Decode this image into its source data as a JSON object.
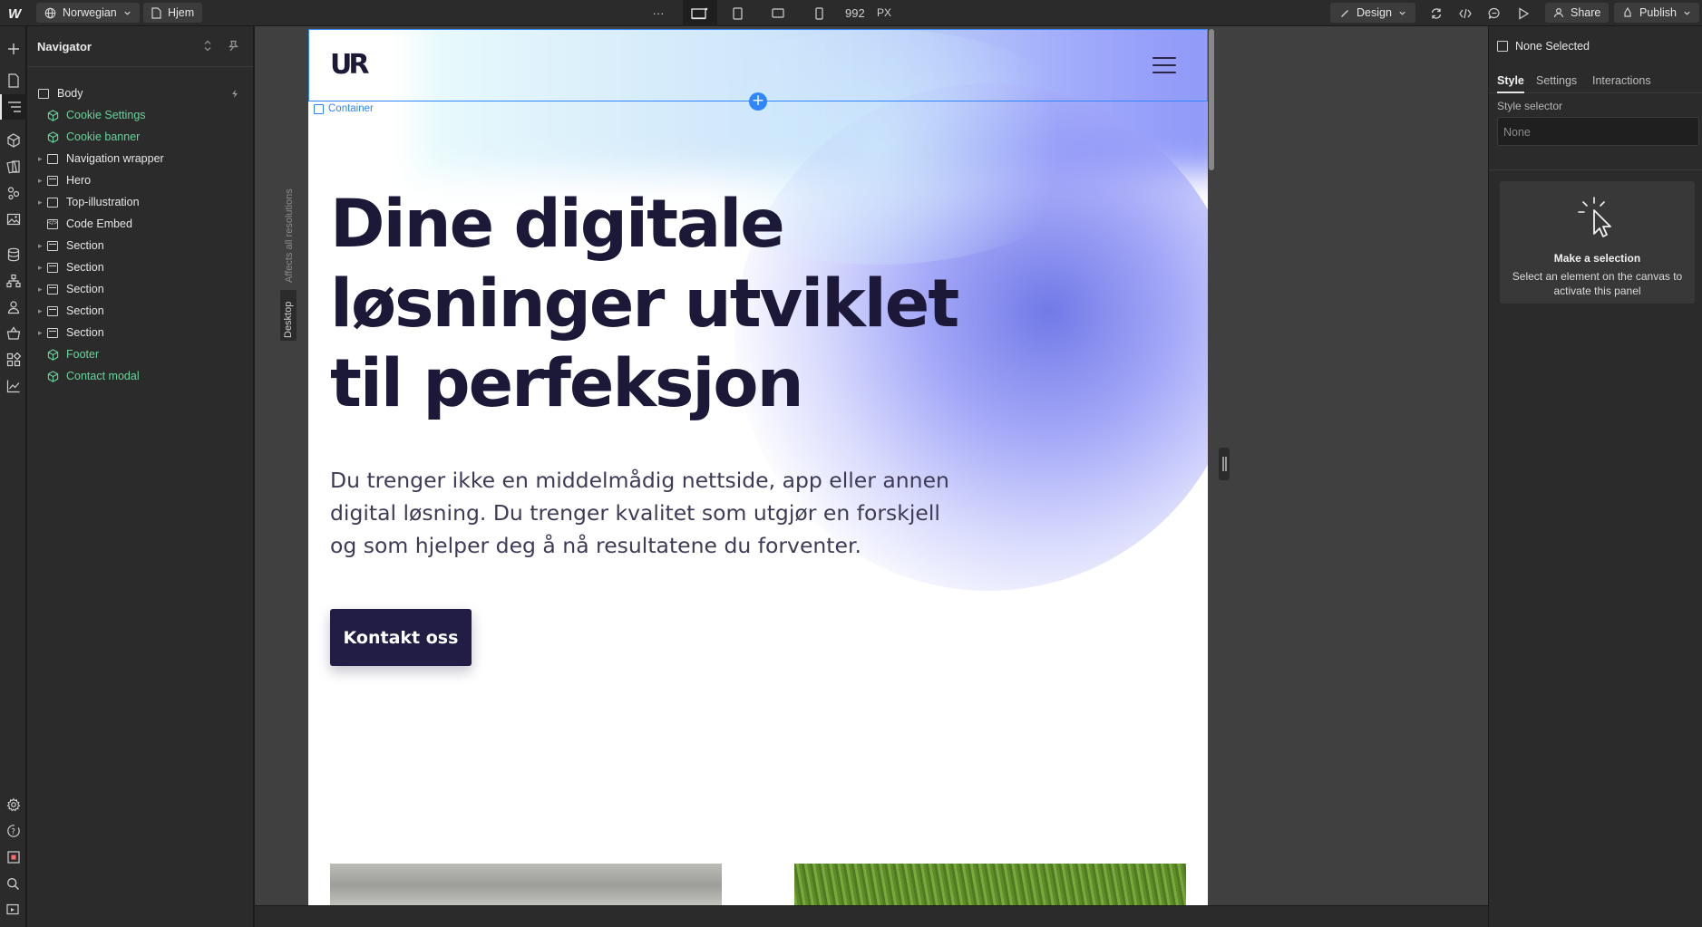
{
  "topbar": {
    "locale_label": "Norwegian",
    "page_label": "Hjem",
    "more_label": "···",
    "width_value": "992",
    "width_unit": "PX",
    "mode_label": "Design",
    "share_label": "Share",
    "publish_label": "Publish"
  },
  "navigator": {
    "title": "Navigator",
    "tree": [
      {
        "label": "Body",
        "kind": "element",
        "indent": 0,
        "expander": false
      },
      {
        "label": "Cookie Settings",
        "kind": "component",
        "indent": 1,
        "expander": false
      },
      {
        "label": "Cookie banner",
        "kind": "component",
        "indent": 1,
        "expander": false
      },
      {
        "label": "Navigation wrapper",
        "kind": "element",
        "indent": 1,
        "expander": true
      },
      {
        "label": "Hero",
        "kind": "section",
        "indent": 1,
        "expander": true
      },
      {
        "label": "Top-illustration",
        "kind": "element",
        "indent": 1,
        "expander": true
      },
      {
        "label": "Code Embed",
        "kind": "code",
        "indent": 1,
        "expander": false
      },
      {
        "label": "Section",
        "kind": "section",
        "indent": 1,
        "expander": true
      },
      {
        "label": "Section",
        "kind": "section",
        "indent": 1,
        "expander": true
      },
      {
        "label": "Section",
        "kind": "section",
        "indent": 1,
        "expander": true
      },
      {
        "label": "Section",
        "kind": "section",
        "indent": 1,
        "expander": true
      },
      {
        "label": "Section",
        "kind": "section",
        "indent": 1,
        "expander": true
      },
      {
        "label": "Footer",
        "kind": "component",
        "indent": 1,
        "expander": false
      },
      {
        "label": "Contact modal",
        "kind": "component",
        "indent": 1,
        "expander": false
      }
    ]
  },
  "canvas": {
    "affects_label": "Affects all resolutions",
    "breakpoint_label": "Desktop",
    "selection_label": "Container"
  },
  "site": {
    "logo": "UR",
    "hero_heading": "Dine digitale løsninger utviklet til perfeksjon",
    "hero_text": "Du trenger ikke en middelmådig nettside, app eller annen digital løsning. Du trenger kvalitet som utgjør en forskjell og som hjelper deg å nå resultatene du forventer.",
    "cta_label": "Kontakt oss"
  },
  "right_panel": {
    "selection_state": "None Selected",
    "tabs": [
      "Style",
      "Settings",
      "Interactions"
    ],
    "style_selector_label": "Style selector",
    "style_selector_placeholder": "None",
    "empty_title": "Make a selection",
    "empty_text": "Select an element on the canvas to activate this panel"
  },
  "colors": {
    "accent": "#2f86ff",
    "component_green": "#66d49a",
    "site_dark": "#1b1838",
    "cta_bg": "#211d44"
  }
}
